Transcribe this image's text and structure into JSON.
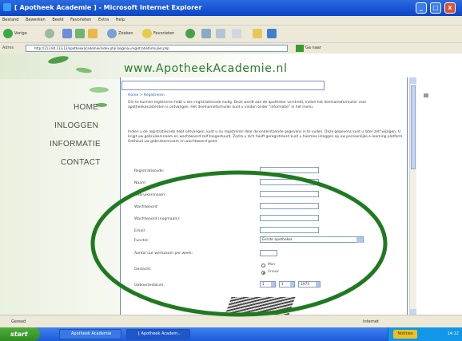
{
  "window": {
    "title": "[ Apotheek Academie ] - Microsoft Internet Explorer",
    "controls": {
      "minimize": "_",
      "maximize": "□",
      "close": "x"
    }
  },
  "menu": [
    "Bestand",
    "Bewerken",
    "Beeld",
    "Favorieten",
    "Extra",
    "Help"
  ],
  "toolbar": {
    "back_label": "Vorige",
    "search_label": "Zoeken",
    "favorites_label": "Favorieten"
  },
  "address": {
    "label": "Adres",
    "url": "http://213.84.113.12/apotheekacademie/index.php?pagina=registratieformulier.php",
    "go_label": "Ga naar"
  },
  "site": {
    "logo": "www.ApotheekAcademie.nl",
    "nav": [
      "HOME",
      "INLOGGEN",
      "INFORMATIE",
      "CONTACT"
    ]
  },
  "content": {
    "breadcrumb": "Home > Registreren",
    "intro_1": "Om te kunnen registreren hebt u een registratiecode nodig. Deze wordt aan de apotheker verstrekt, indien het deelnameformulier voor apotheekassistenten is ontvangen. Het deelnameformulier kunt u vinden onder \"informatie\" in het menu.",
    "intro_2": "Indien u de registratiecode hebt ontvangen, kunt u nu registreren door de onderstaande gegevens in te vullen. Deze gegevens kunt u later zelf wijzigen. U krijgt uw gebruikersnaam en wachtwoord zelf toegestuurd. Zodra u zich heeft geregistreerd kunt u hiermee inloggen op uw persoonlijke e-learning platform. Onthoud uw gebruikersnaam en wachtwoord goed."
  },
  "form": {
    "fields": [
      "Registratiecode:",
      "Naam:",
      "Gebruikersnaam:",
      "Wachtwoord:",
      "Wachtwoord (nogmaals):",
      "Email:"
    ],
    "functie_label": "Functie:",
    "functie_value": "Eerste apotheker",
    "uren_label": "Aantal uur werkzaam per week:",
    "geslacht_label": "Geslacht:",
    "gender_options": [
      "Man",
      "Vrouw"
    ],
    "gender_selected": "Vrouw",
    "geboortedatum_label": "Geboortedatum:",
    "birth_day": "1",
    "birth_month": "1",
    "birth_year": "1975"
  },
  "statusbar": {
    "text": "Gereed",
    "zone": "Internet"
  },
  "taskbar": {
    "start": "start",
    "items": [
      "Apotheek Academie",
      "[ Apotheek Academ..."
    ],
    "tray_app": "Notities",
    "clock": "14:12"
  },
  "colors": {
    "annotation": "#1f7a1f",
    "logo": "#2a7a2a",
    "link": "#2a5fa8",
    "titlebar": "#0a45c6"
  }
}
